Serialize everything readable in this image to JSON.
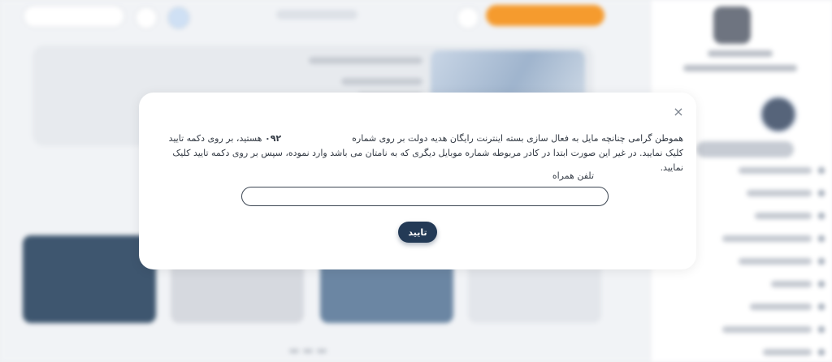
{
  "modal": {
    "message_part1": "هموطن گرامی چنانچه مایل به فعال سازی بسته اینترنت رایگان هدیه دولت بر روی شماره",
    "phone_prefix": "۰۹۲",
    "message_part2": "هستید، بر روی دکمه تایید کلیک نمایید. در غیر این صورت ابتدا در کادر مربوطه شماره موبایل دیگری که به نامتان می باشد وارد نموده، سپس بر روی دکمه تایید کلیک نمایید.",
    "phone_label": "تلفن همراه",
    "phone_value": "",
    "confirm_label": "تایید",
    "close_symbol": "×"
  }
}
